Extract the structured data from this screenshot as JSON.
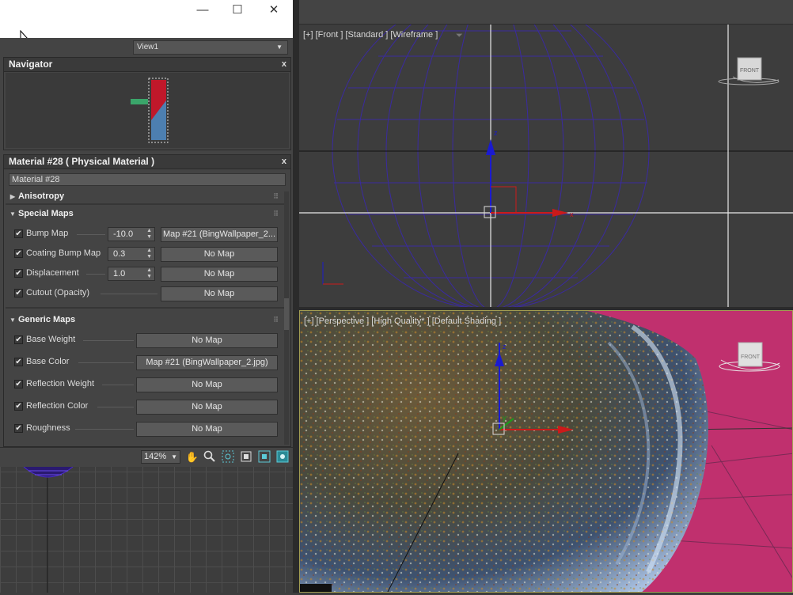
{
  "window": {
    "minimize_glyph": "—",
    "maximize_glyph": "☐",
    "close_glyph": "✕",
    "view_select": "View1"
  },
  "navigator": {
    "title": "Navigator",
    "close": "x"
  },
  "material": {
    "title": "Material #28  ( Physical Material )",
    "close": "x",
    "name_value": "Material #28",
    "rollouts": {
      "anisotropy": "Anisotropy",
      "special_maps": "Special Maps",
      "generic_maps": "Generic Maps"
    },
    "special_maps": [
      {
        "label": "Bump Map",
        "checked": true,
        "spinner": "-10.0",
        "map": "Map #21 (BingWallpaper_2..."
      },
      {
        "label": "Coating Bump Map",
        "checked": true,
        "spinner": "0.3",
        "map": "No Map"
      },
      {
        "label": "Displacement",
        "checked": true,
        "spinner": "1.0",
        "map": "No Map"
      },
      {
        "label": "Cutout (Opacity)",
        "checked": true,
        "map": "No Map"
      }
    ],
    "generic_maps": [
      {
        "label": "Base Weight",
        "checked": true,
        "map": "No Map"
      },
      {
        "label": "Base Color",
        "checked": true,
        "map": "Map #21 (BingWallpaper_2.jpg)"
      },
      {
        "label": "Reflection Weight",
        "checked": true,
        "map": "No Map"
      },
      {
        "label": "Reflection Color",
        "checked": true,
        "map": "No Map"
      },
      {
        "label": "Roughness",
        "checked": true,
        "map": "No Map"
      }
    ]
  },
  "toolbar": {
    "zoom": "142%",
    "icons": [
      "pan-hand-icon",
      "zoom-magnifier-icon",
      "zoom-region-icon",
      "fit-view-icon",
      "frame-selected-icon",
      "render-preview-icon"
    ]
  },
  "viewports": {
    "front_label": "[+] [Front ] [Standard ] [Wireframe ]",
    "persp_label": "[+] [Perspective ] [High Quality* ] [Default Shading ]",
    "viewcube_front": "FRONT",
    "axis_z": "z",
    "axis_x": "x",
    "axis_y": "y"
  },
  "colors": {
    "ui_bg": "#444444",
    "viewport_bg": "#3d3d3d",
    "wire_color": "#3a2a9a",
    "perspective_bg": "#c0306e",
    "axis_red": "#cc1a1a",
    "axis_blue": "#1a1acc",
    "axis_green": "#1aa01a"
  }
}
